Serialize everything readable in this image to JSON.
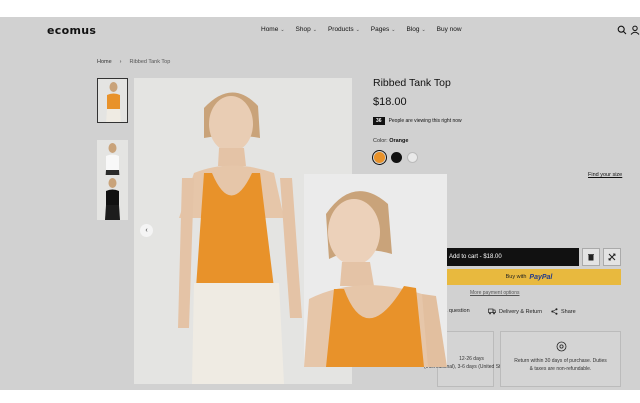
{
  "brand": {
    "logo": "ecomus"
  },
  "nav": [
    {
      "label": "Home",
      "has_dropdown": true
    },
    {
      "label": "Shop",
      "has_dropdown": true
    },
    {
      "label": "Products",
      "has_dropdown": true
    },
    {
      "label": "Pages",
      "has_dropdown": true
    },
    {
      "label": "Blog",
      "has_dropdown": true
    },
    {
      "label": "Buy now",
      "has_dropdown": false
    }
  ],
  "header_icons": [
    "search-icon",
    "user-icon"
  ],
  "breadcrumb": {
    "home": "Home",
    "separator": "›",
    "current": "Ribbed Tank Top"
  },
  "product": {
    "title": "Ribbed Tank Top",
    "price": "$18.00",
    "viewing_count": "36",
    "viewing_text": "People are viewing this right now",
    "color_label": "Color:",
    "color_value": "Orange",
    "swatches": [
      {
        "name": "Orange",
        "color": "#e8922a",
        "selected": true
      },
      {
        "name": "Black",
        "color": "#111111",
        "selected": false
      },
      {
        "name": "White",
        "color": "#ffffff",
        "selected": false
      }
    ],
    "find_size": "Find your size",
    "add_to_cart": "Add to cart - $18.00",
    "buy_with": "Buy with",
    "paypal": "PayPal",
    "more_payment": "More payment options",
    "actions": {
      "ask": "k a question",
      "delivery": "Delivery & Return",
      "share": "Share"
    },
    "delivery_card": {
      "line1": "12-26 days",
      "line2": "(International), 3-6 days (United States)."
    },
    "return_card": {
      "line1": "Return within 30 days of purchase. Duties",
      "line2": "& taxes are non-refundable."
    }
  },
  "colors": {
    "accent": "#e8922a",
    "paypal": "#e8b93e",
    "background": "#d1d1d1"
  }
}
